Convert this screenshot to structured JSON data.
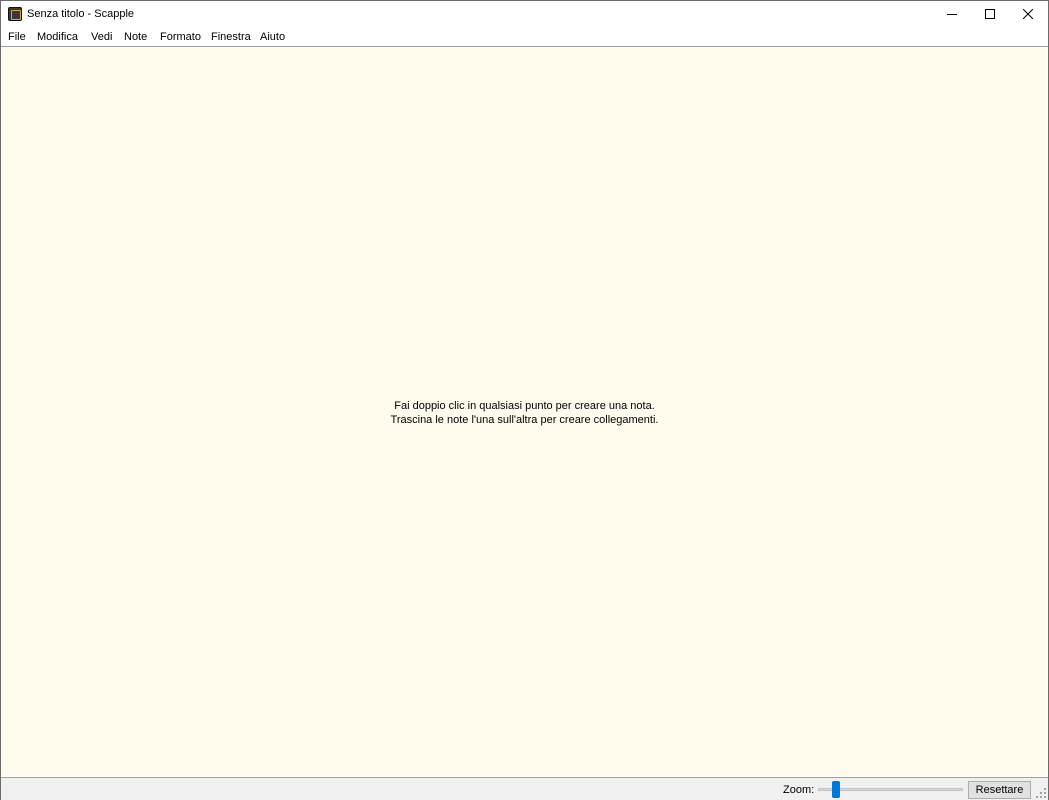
{
  "window": {
    "title": "Senza titolo - Scapple",
    "app_icon": "scapple-app-icon",
    "controls": [
      "minimize-icon",
      "maximize-icon",
      "close-icon"
    ]
  },
  "menubar": {
    "items": [
      {
        "label": "File"
      },
      {
        "label": "Modifica"
      },
      {
        "label": "Vedi"
      },
      {
        "label": "Note"
      },
      {
        "label": "Formato"
      },
      {
        "label": "Finestra"
      },
      {
        "label": "Aiuto"
      }
    ]
  },
  "canvas": {
    "background": "#fffcee",
    "hint_line1": "Fai doppio clic in qualsiasi punto per creare una nota.",
    "hint_line2": "Trascina le note l'una sull'altra per creare collegamenti."
  },
  "statusbar": {
    "zoom_label": "Zoom:",
    "zoom_slider_position": 0.1,
    "reset_label": "Resettare",
    "accent": "#0078d7"
  }
}
